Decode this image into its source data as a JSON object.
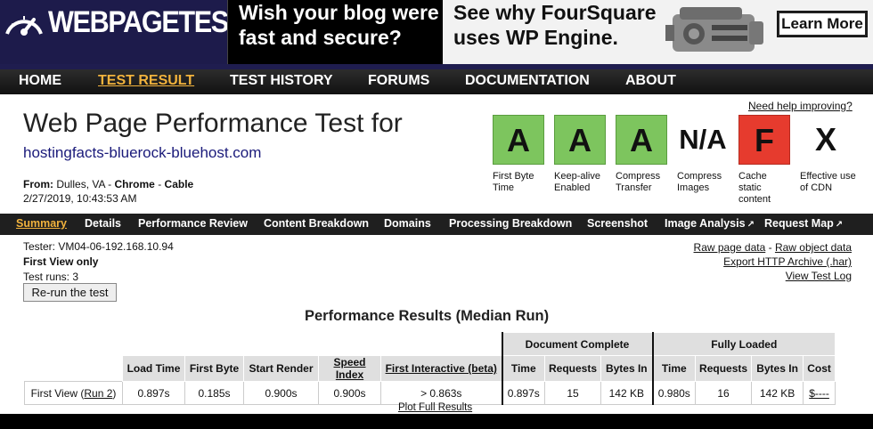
{
  "logo": {
    "text": "WEBPAGETEST"
  },
  "ad": {
    "left_line1": "Wish your blog were",
    "left_line2": "fast and secure?",
    "right_line1": "See why FourSquare",
    "right_line2": "uses WP Engine.",
    "button": "Learn More"
  },
  "nav": [
    "HOME",
    "TEST RESULT",
    "TEST HISTORY",
    "FORUMS",
    "DOCUMENTATION",
    "ABOUT"
  ],
  "page": {
    "title": "Web Page Performance Test for",
    "url": "hostingfacts-bluerock-bluehost.com",
    "from_label": "From:",
    "from_location": "Dulles, VA -",
    "from_browser": "Chrome",
    "from_sep": "-",
    "from_conn": "Cable",
    "date": "2/27/2019, 10:43:53 AM",
    "help_link": "Need help improving?"
  },
  "grades": [
    {
      "grade": "A",
      "label": "First Byte Time",
      "color": "#7dc55e"
    },
    {
      "grade": "A",
      "label": "Keep-alive Enabled",
      "color": "#7dc55e"
    },
    {
      "grade": "A",
      "label": "Compress Transfer",
      "color": "#7dc55e"
    },
    {
      "grade": "N/A",
      "label": "Compress Images",
      "color": ""
    },
    {
      "grade": "F",
      "label": "Cache static content",
      "color": "#e63b2e"
    },
    {
      "grade": "X",
      "label": "Effective use of CDN",
      "color": ""
    }
  ],
  "subnav": [
    "Summary",
    "Details",
    "Performance Review",
    "Content Breakdown",
    "Domains",
    "Processing Breakdown",
    "Screenshot",
    "Image Analysis",
    "Request Map"
  ],
  "test_info": {
    "tester": "Tester: VM04-06-192.168.10.94",
    "first_view_only": "First View only",
    "test_runs": "Test runs: 3",
    "rerun_button": "Re-run the test"
  },
  "raw_links": {
    "raw_page": "Raw page data",
    "sep": " - ",
    "raw_object": "Raw object data",
    "export_har": "Export HTTP Archive (.har)",
    "view_log": "View Test Log"
  },
  "results": {
    "title": "Performance Results (Median Run)",
    "group_doc": "Document Complete",
    "group_full": "Fully Loaded",
    "headers": [
      "Load Time",
      "First Byte",
      "Start Render",
      "Speed Index",
      "First Interactive (beta)",
      "Time",
      "Requests",
      "Bytes In",
      "Time",
      "Requests",
      "Bytes In",
      "Cost"
    ],
    "row_label": "First View (",
    "row_link": "Run 2",
    "row_label_end": ")",
    "row": [
      "0.897s",
      "0.185s",
      "0.900s",
      "0.900s",
      "> 0.863s",
      "0.897s",
      "15",
      "142 KB",
      "0.980s",
      "16",
      "142 KB",
      "$----"
    ],
    "plot_link": "Plot Full Results"
  }
}
